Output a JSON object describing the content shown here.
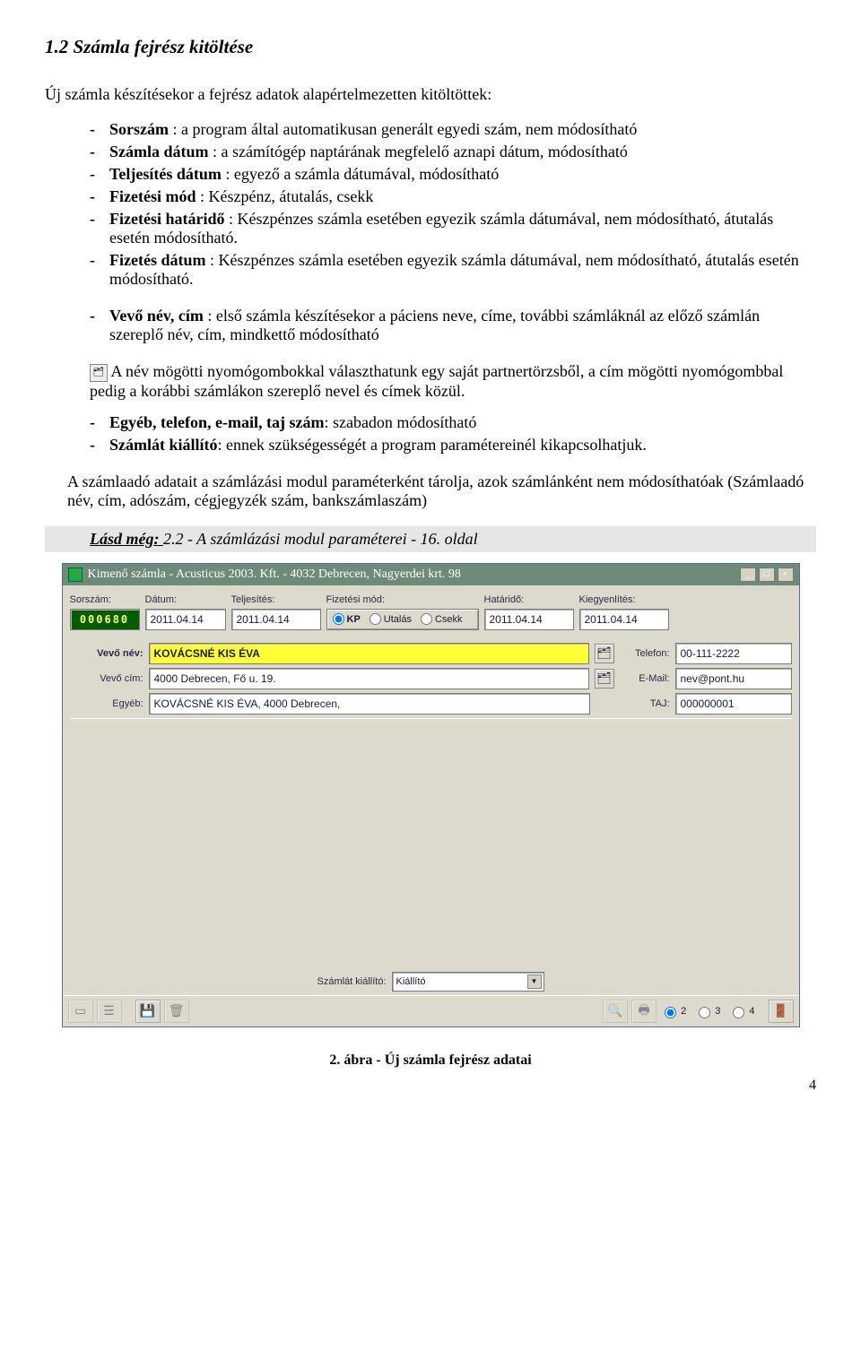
{
  "doc": {
    "heading": "1.2  Számla fejrész kitöltése",
    "intro": "Új számla készítésekor a fejrész adatok alapértelmezetten kitöltöttek:",
    "bullets1": [
      {
        "term": "Sorszám",
        "rest": " : a program által automatikusan generált egyedi szám, nem módosítható"
      },
      {
        "term": "Számla dátum",
        "rest": " : a számítógép naptárának megfelelő aznapi dátum, módosítható"
      },
      {
        "term": "Teljesítés dátum",
        "rest": " : egyező a számla dátumával, módosítható"
      },
      {
        "term": "Fizetési mód",
        "rest": " : Készpénz,  átutalás, csekk"
      },
      {
        "term": "Fizetési határidő",
        "rest": " : Készpénzes számla esetében egyezik számla dátumával, nem módosítható, átutalás esetén módosítható."
      },
      {
        "term": "Fizetés dátum",
        "rest": " : Készpénzes számla esetében egyezik számla dátumával, nem módosítható, átutalás esetén módosítható."
      }
    ],
    "bullets2_term": "Vevő név, cím",
    "bullets2_rest": " : első számla készítésekor a páciens neve, címe, további számláknál az előző számlán szereplő név, cím, mindkettő módosítható",
    "icon_hint": "  A név  mögötti nyomógombokkal választhatunk egy saját partnertörzsből, a cím mögötti nyomógombbal pedig a korábbi számlákon szereplő nevel és címek közül.",
    "bullets3": [
      {
        "term": "Egyéb, telefon, e-mail, taj szám",
        "rest": ": szabadon módosítható"
      },
      {
        "term": "Számlát kiállító",
        "rest": ": ennek szükségességét a program paramétereinél kikapcsolhatjuk."
      }
    ],
    "szamlaado": "A számlaadó adatait a számlázási modul paraméterként tárolja, azok számlánként nem módosíthatóak (Számlaadó név, cím, adószám, cégjegyzék szám, bankszámlaszám)",
    "see_also_label": "Lásd még: ",
    "see_also_rest": "2.2 - A számlázási modul paraméterei - 16. oldal",
    "caption": "2. ábra - Új számla fejrész adatai",
    "page_number": "4"
  },
  "win": {
    "title": "Kimenő számla - Acusticus 2003. Kft. - 4032 Debrecen, Nagyerdei krt. 98",
    "labels": {
      "sorszam": "Sorszám:",
      "datum": "Dátum:",
      "teljesites": "Teljesítés:",
      "fizmod": "Fizetési mód:",
      "hatarido": "Határidő:",
      "kiegyenlites": "Kiegyenlítés:",
      "vevo_nev": "Vevő név:",
      "telefon": "Telefon:",
      "vevo_cim": "Vevő cím:",
      "email": "E-Mail:",
      "egyeb": "Egyéb:",
      "taj": "TAJ:",
      "kiallito": "Számlát kiállító:"
    },
    "values": {
      "sorszam": "000680",
      "datum": "2011.04.14",
      "teljesites": "2011.04.14",
      "hatarido": "2011.04.14",
      "kiegyenlites": "2011.04.14",
      "vevo_nev": "KOVÁCSNÉ KIS ÉVA",
      "telefon": "00-111-2222",
      "vevo_cim": "4000 Debrecen, Fő u. 19.",
      "email": "nev@pont.hu",
      "egyeb": "KOVÁCSNÉ KIS ÉVA, 4000 Debrecen,",
      "taj": "000000001",
      "kiallito": "Kiállító"
    },
    "fizmod_options": {
      "kp": "KP",
      "utalas": "Utalás",
      "csekk": "Csekk"
    },
    "copies": {
      "c2": "2",
      "c3": "3",
      "c4": "4"
    }
  }
}
